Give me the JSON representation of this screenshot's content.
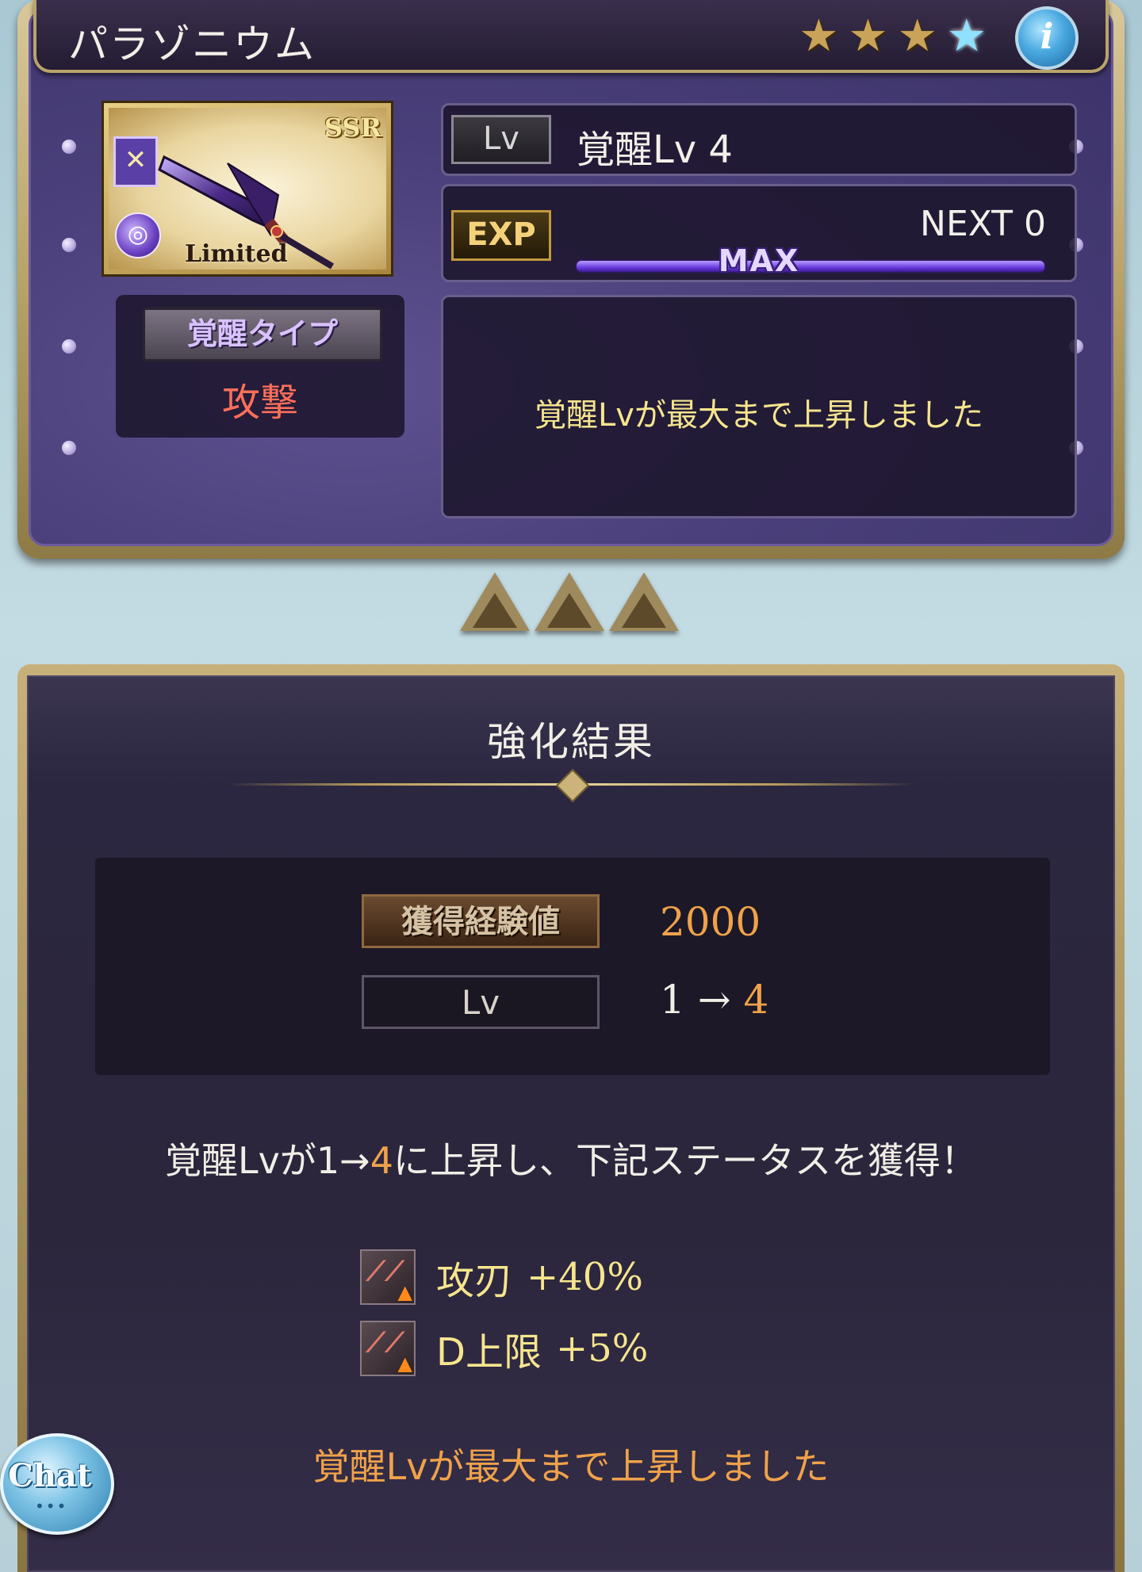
{
  "weapon": {
    "name": "パラゾニウム",
    "stars": [
      "star-icon",
      "star-icon",
      "star-icon",
      "star-blue-icon"
    ],
    "rarity": "SSR",
    "limited_label": "Limited",
    "info_icon": "info-icon"
  },
  "awakening": {
    "type_label": "覚醒タイプ",
    "type_value": "攻撃"
  },
  "level": {
    "tag": "Lv",
    "text": "覚醒Lv 4"
  },
  "exp": {
    "tag": "EXP",
    "next_text": "NEXT 0",
    "bar_label": "MAX",
    "progress": 1.0
  },
  "status_message": "覚醒Lvが最大まで上昇しました",
  "result": {
    "title": "強化結果",
    "exp_label": "獲得経験値",
    "exp_value": "2000",
    "lv_label": "Lv",
    "lv_from": "1",
    "lv_arrow": "→",
    "lv_to": "4",
    "desc_prefix": "覚醒Lvが1→",
    "desc_highlight": "4",
    "desc_suffix": "に上昇し、下記ステータスを獲得！",
    "skills": [
      {
        "name": "攻刃",
        "bonus": "+40%"
      },
      {
        "name": "D上限",
        "bonus": "+5%"
      }
    ],
    "final_message": "覚醒Lvが最大まで上昇しました"
  },
  "chat": {
    "label": "Chat",
    "dots": "•••"
  },
  "colors": {
    "accent_orange": "#f0a24a",
    "accent_yellow": "#f6e58e",
    "attack_red": "#ff6f5a",
    "panel_purple": "#4a3f7a"
  }
}
